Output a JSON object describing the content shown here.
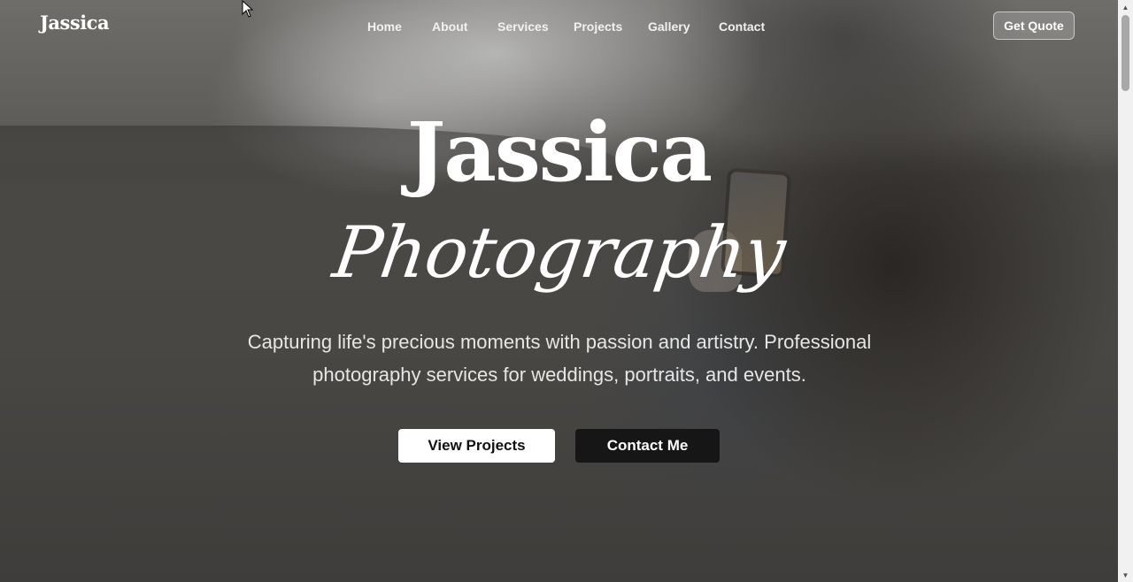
{
  "brand": {
    "logo_text": "Jassica"
  },
  "nav": {
    "items": [
      {
        "label": "Home"
      },
      {
        "label": "About"
      },
      {
        "label": "Services"
      },
      {
        "label": "Projects"
      },
      {
        "label": "Gallery"
      },
      {
        "label": "Contact"
      }
    ],
    "cta_label": "Get Quote"
  },
  "hero": {
    "title": "Jassica",
    "subtitle": "Photography",
    "tagline": "Capturing life's precious moments with passion and artistry. Professional photography services for weddings, portraits, and events.",
    "primary_button": "View Projects",
    "secondary_button": "Contact Me"
  },
  "icons": {
    "scroll_up": "scroll-up-arrow",
    "scroll_down": "scroll-down-arrow",
    "cursor": "mouse-pointer"
  },
  "colors": {
    "dark_button": "#161616",
    "light_button": "#ffffff",
    "text": "#ffffff"
  }
}
